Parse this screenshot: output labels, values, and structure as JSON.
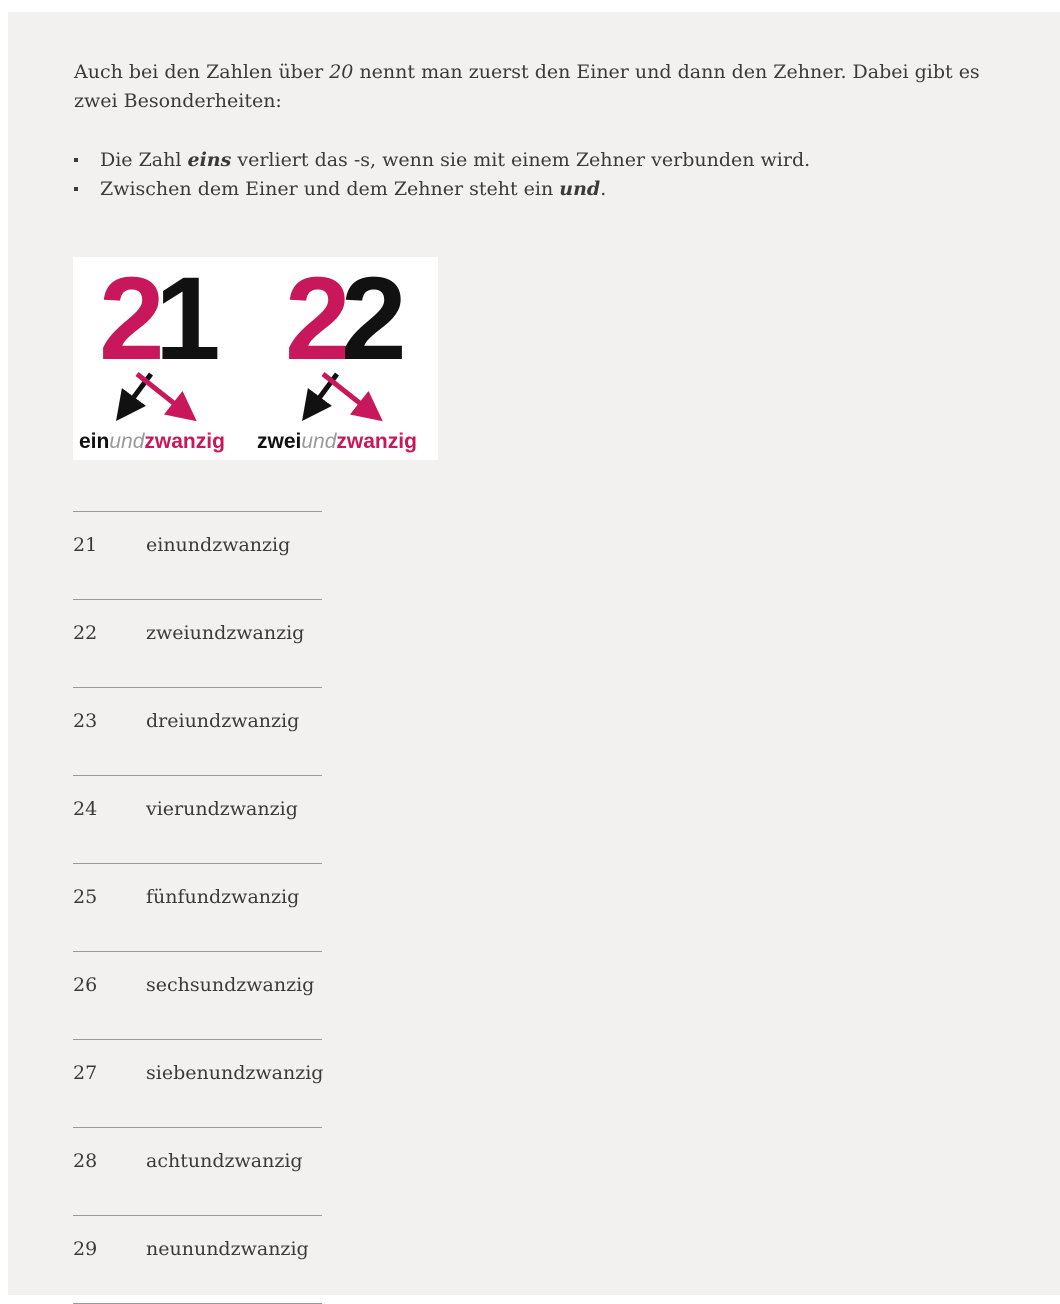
{
  "intro": {
    "part1": "Auch bei den Zahlen über ",
    "num20": "20",
    "part2": " nennt man zuerst den Einer und dann den Zehner. Dabei gibt es zwei Besonderheiten:"
  },
  "bullets": [
    {
      "pre": "Die Zahl ",
      "em": "eins",
      "post": " verliert das -s, wenn sie mit einem Zehner verbunden wird."
    },
    {
      "pre": "Zwischen dem Einer und dem Zehner steht ein ",
      "em": "und",
      "post": "."
    }
  ],
  "graphic": {
    "colors": {
      "accent": "#c8175a",
      "dark": "#111111",
      "light": "#9a9a9a"
    },
    "items": [
      {
        "tens_digit": "2",
        "ones_digit": "1",
        "w_ones": "ein",
        "w_und": "und",
        "w_tens": "zwanzig"
      },
      {
        "tens_digit": "2",
        "ones_digit": "2",
        "w_ones": "zwei",
        "w_und": "und",
        "w_tens": "zwanzig"
      }
    ]
  },
  "numbers": [
    {
      "num": "21",
      "word": "einundzwanzig"
    },
    {
      "num": "22",
      "word": "zweiundzwanzig"
    },
    {
      "num": "23",
      "word": "dreiundzwanzig"
    },
    {
      "num": "24",
      "word": "vierundzwanzig"
    },
    {
      "num": "25",
      "word": "fünfundzwanzig"
    },
    {
      "num": "26",
      "word": "sechsundzwanzig"
    },
    {
      "num": "27",
      "word": "siebenundzwanzig"
    },
    {
      "num": "28",
      "word": "achtundzwanzig"
    },
    {
      "num": "29",
      "word": "neunundzwanzig"
    }
  ]
}
